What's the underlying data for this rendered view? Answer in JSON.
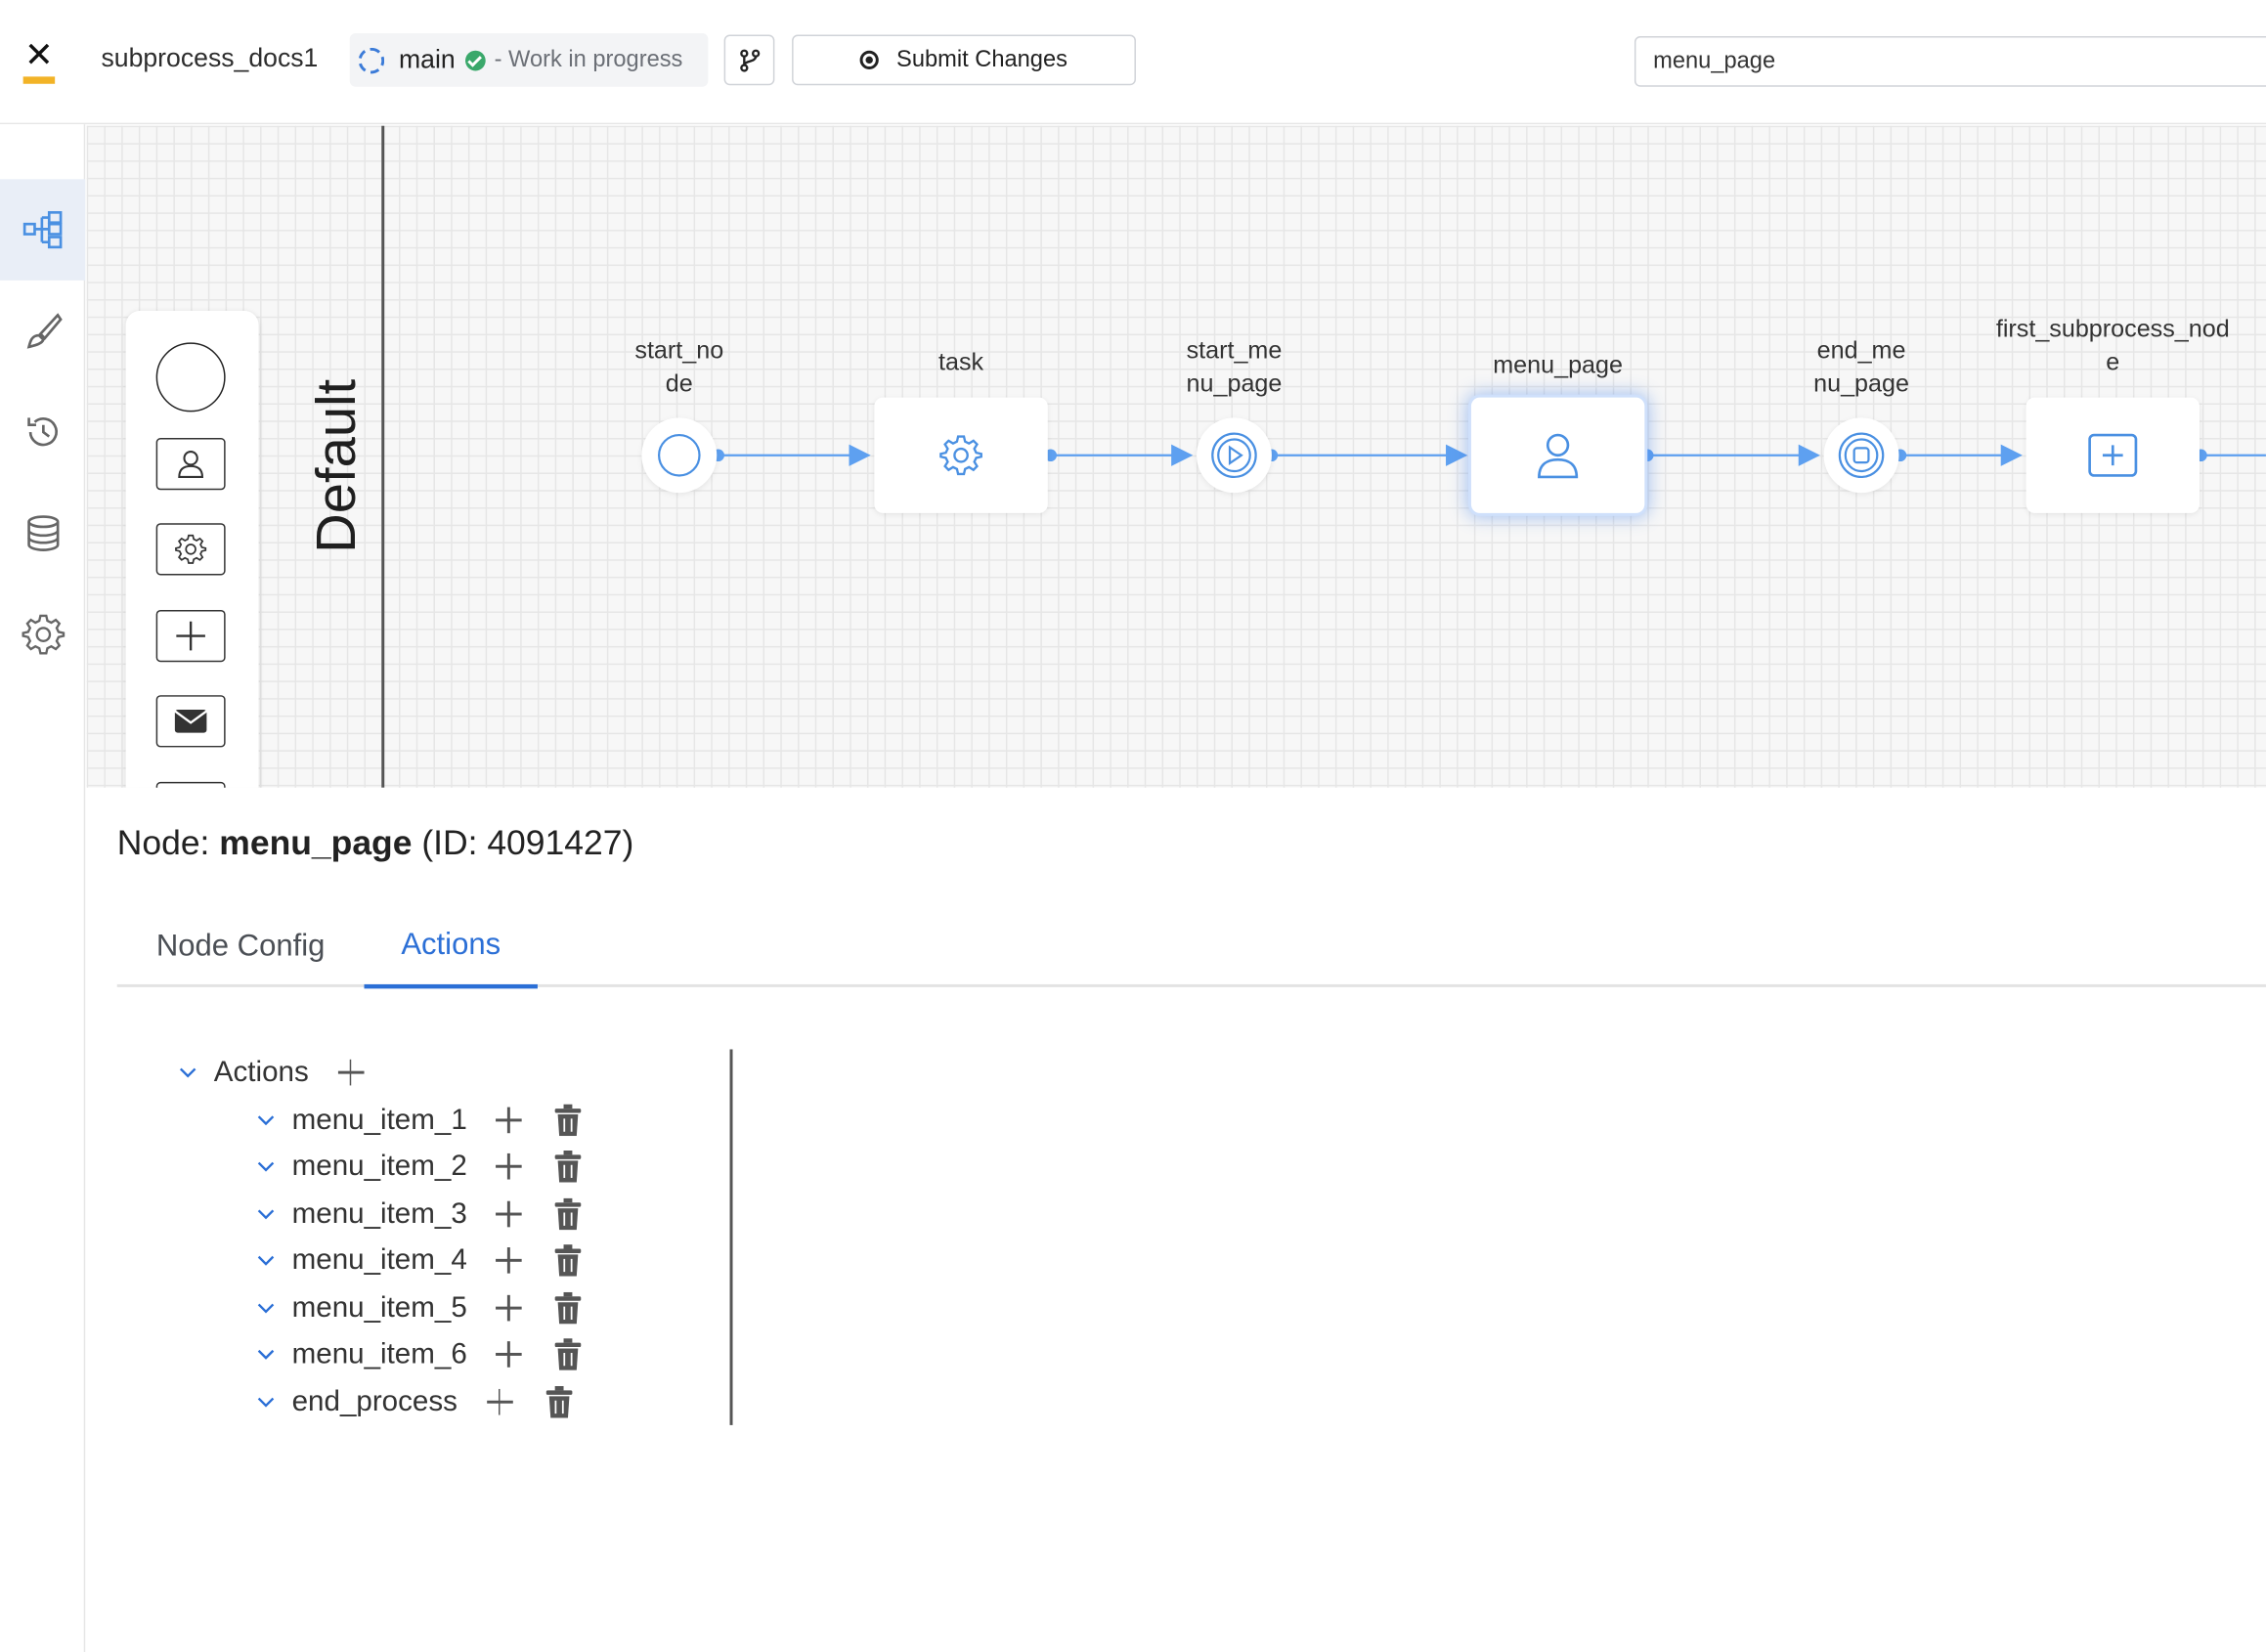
{
  "header": {
    "project_name": "subprocess_docs1",
    "branch": "main",
    "branch_status": "- Work in progress",
    "submit_label": "Submit Changes",
    "search_value": "menu_page"
  },
  "canvas": {
    "lane_label": "Default",
    "nodes": [
      {
        "label": "start_no\nde",
        "kind": "start"
      },
      {
        "label": "task",
        "kind": "service-task"
      },
      {
        "label": "start_me\nnu_page",
        "kind": "start-milestone"
      },
      {
        "label": "menu_page",
        "kind": "user-task"
      },
      {
        "label": "end_me\nnu_page",
        "kind": "end-milestone"
      },
      {
        "label": "first_subprocess_nod\ne",
        "kind": "subprocess"
      }
    ]
  },
  "details": {
    "title_prefix": "Node: ",
    "node_name": "menu_page",
    "node_id": "(ID: 4091427)",
    "tabs": [
      "Node Config",
      "Actions"
    ],
    "active_tab": "Actions",
    "tree_root": "Actions",
    "actions": [
      "menu_item_1",
      "menu_item_2",
      "menu_item_3",
      "menu_item_4",
      "menu_item_5",
      "menu_item_6",
      "end_process"
    ]
  },
  "colors": {
    "accent": "#2b6fd6",
    "node_icon": "#4a90e2",
    "edge": "#5ea0f0",
    "logo_bar": "#f2b327",
    "status_ok": "#3aa86b"
  }
}
